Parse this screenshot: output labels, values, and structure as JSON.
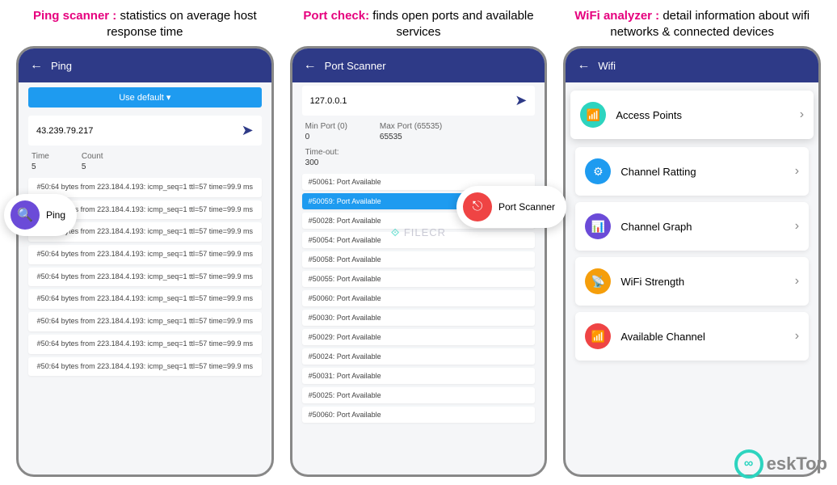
{
  "panels": {
    "ping": {
      "title_highlight": "Ping scanner :",
      "title_rest": " statistics on average host response time",
      "header": "Ping",
      "dropdown": "Use default ▾",
      "ip": "43.239.79.217",
      "time_label": "Time",
      "time_value": "5",
      "count_label": "Count",
      "count_value": "5",
      "badge_label": "Ping",
      "results": [
        "#50:64 bytes from 223.184.4.193: icmp_seq=1 ttl=57 time=99.9 ms",
        "#50:64 bytes from 223.184.4.193: icmp_seq=1 ttl=57 time=99.9 ms",
        "#50:64 bytes from 223.184.4.193: icmp_seq=1 ttl=57 time=99.9 ms",
        "#50:64 bytes from 223.184.4.193: icmp_seq=1 ttl=57 time=99.9 ms",
        "#50:64 bytes from 223.184.4.193: icmp_seq=1 ttl=57 time=99.9 ms",
        "#50:64 bytes from 223.184.4.193: icmp_seq=1 ttl=57 time=99.9 ms",
        "#50:64 bytes from 223.184.4.193: icmp_seq=1 ttl=57 time=99.9 ms",
        "#50:64 bytes from 223.184.4.193: icmp_seq=1 ttl=57 time=99.9 ms",
        "#50:64 bytes from 223.184.4.193: icmp_seq=1 ttl=57 time=99.9 ms"
      ]
    },
    "port": {
      "title_highlight": "Port check:",
      "title_rest": " finds open ports and available services",
      "header": "Port Scanner",
      "ip": "127.0.0.1",
      "minport_label": "Min Port (0)",
      "minport_value": "0",
      "maxport_label": "Max Port (65535)",
      "maxport_value": "65535",
      "timeout_label": "Time-out:",
      "timeout_value": "300",
      "badge_label": "Port Scanner",
      "results": [
        {
          "text": "#50061: Port Available",
          "hl": false
        },
        {
          "text": "#50059: Port Available",
          "hl": true
        },
        {
          "text": "#50028: Port Available",
          "hl": false
        },
        {
          "text": "#50054: Port Available",
          "hl": false
        },
        {
          "text": "#50058: Port Available",
          "hl": false
        },
        {
          "text": "#50055: Port Available",
          "hl": false
        },
        {
          "text": "#50060: Port Available",
          "hl": false
        },
        {
          "text": "#50030: Port Available",
          "hl": false
        },
        {
          "text": "#50029: Port Available",
          "hl": false
        },
        {
          "text": "#50024: Port Available",
          "hl": false
        },
        {
          "text": "#50031: Port Available",
          "hl": false
        },
        {
          "text": "#50025: Port Available",
          "hl": false
        },
        {
          "text": "#50060: Port Available",
          "hl": false
        }
      ]
    },
    "wifi": {
      "title_highlight": "WiFi analyzer :",
      "title_rest": " detail information about wifi networks & connected devices",
      "header": "Wifi",
      "items": [
        {
          "label": "Access Points",
          "color": "#2dd4bf",
          "glyph": "📶",
          "floating": true
        },
        {
          "label": "Channel Ratting",
          "color": "#1e9bf0",
          "glyph": "⚙",
          "floating": false
        },
        {
          "label": "Channel Graph",
          "color": "#6b4bd8",
          "glyph": "📊",
          "floating": false
        },
        {
          "label": "WiFi Strength",
          "color": "#f59e0b",
          "glyph": "📡",
          "floating": false
        },
        {
          "label": "Available Channel",
          "color": "#ef4444",
          "glyph": "📶",
          "floating": false
        }
      ]
    }
  },
  "watermark": {
    "filecr": "FILECR",
    "desktop": "eskTop"
  }
}
